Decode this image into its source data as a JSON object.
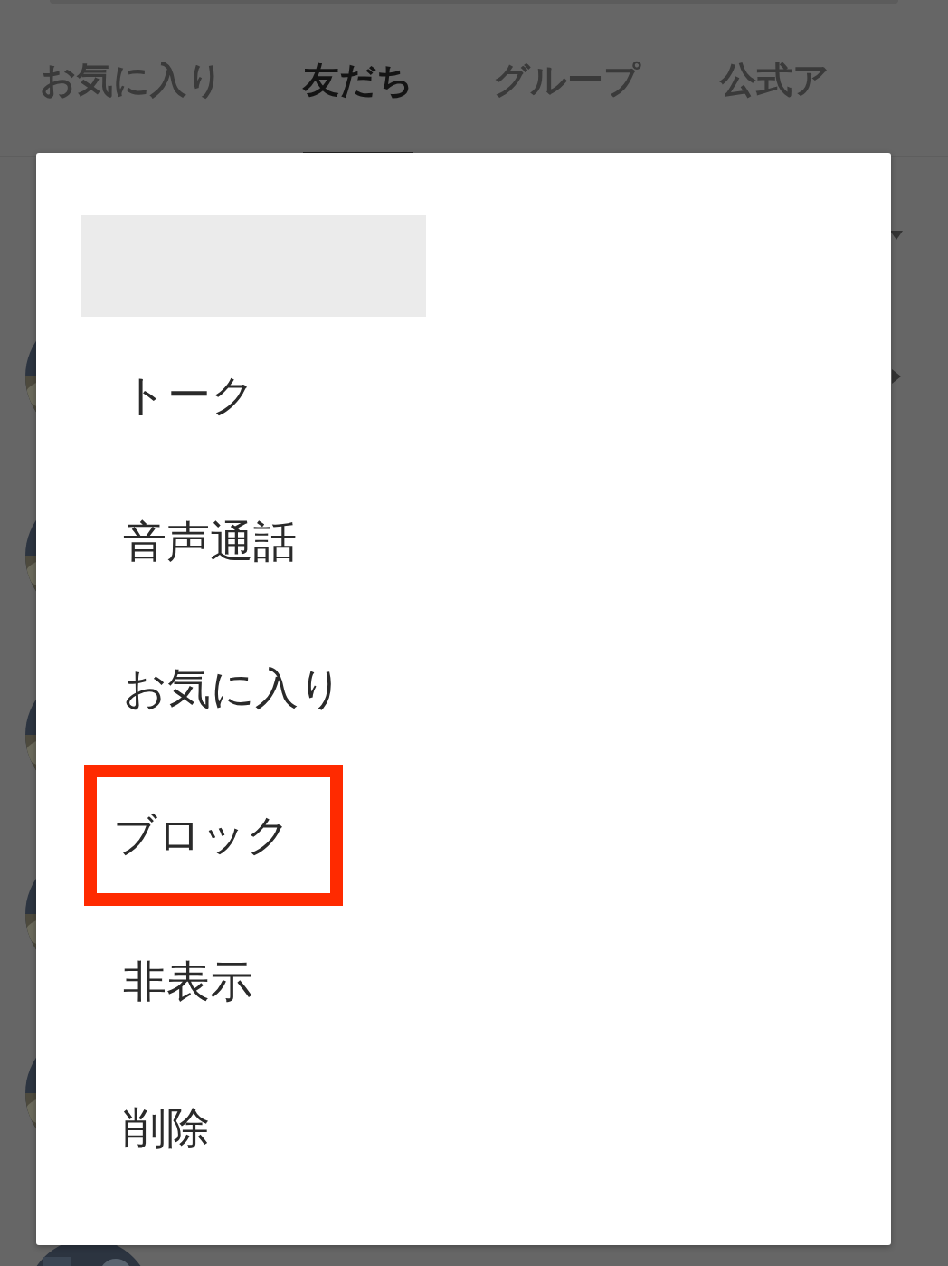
{
  "tabs": [
    {
      "label": "お気に入り",
      "selected": false
    },
    {
      "label": "友だち",
      "selected": true
    },
    {
      "label": "グループ",
      "selected": false
    },
    {
      "label": "公式ア",
      "selected": false
    }
  ],
  "menu": {
    "items": [
      {
        "label": "トーク",
        "highlighted": false
      },
      {
        "label": "音声通話",
        "highlighted": false
      },
      {
        "label": "お気に入り",
        "highlighted": false
      },
      {
        "label": "ブロック",
        "highlighted": true
      },
      {
        "label": "非表示",
        "highlighted": false
      },
      {
        "label": "削除",
        "highlighted": false
      }
    ]
  }
}
